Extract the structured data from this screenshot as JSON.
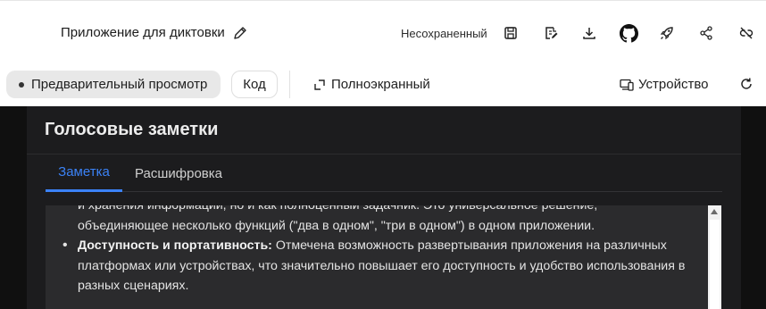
{
  "header": {
    "app_title": "Приложение для диктовки",
    "save_status": "Несохраненный",
    "icons": [
      "pencil-icon",
      "save-icon",
      "edit-file-icon",
      "download-icon",
      "github-icon",
      "rocket-icon",
      "share-icon",
      "link-off-icon"
    ]
  },
  "toolbar": {
    "preview_label": "Предварительный просмотр",
    "code_label": "Код",
    "fullscreen_label": "Полноэкранный",
    "device_label": "Устройство"
  },
  "app": {
    "title": "Голосовые заметки",
    "tabs": [
      {
        "label": "Заметка",
        "active": true
      },
      {
        "label": "Расшифровка",
        "active": false
      }
    ],
    "content": {
      "line1": "и хранения информации, но и как полноценный задачник. Это универсальное решение,",
      "line2": "объединяющее несколько функций (\"два в одном\", \"три в одном\") в одном приложении.",
      "bullet_title": "Доступность и портативность:",
      "bullet_text": " Отмечена возможность развертывания приложения на различных платформах или устройствах, что значительно повышает его доступность и удобство использования в разных сценариях."
    }
  },
  "colors": {
    "accent": "#3b82f6",
    "dark_bg": "#101010",
    "card_bg": "#1c1c1e",
    "content_bg": "#2b2b2d"
  }
}
